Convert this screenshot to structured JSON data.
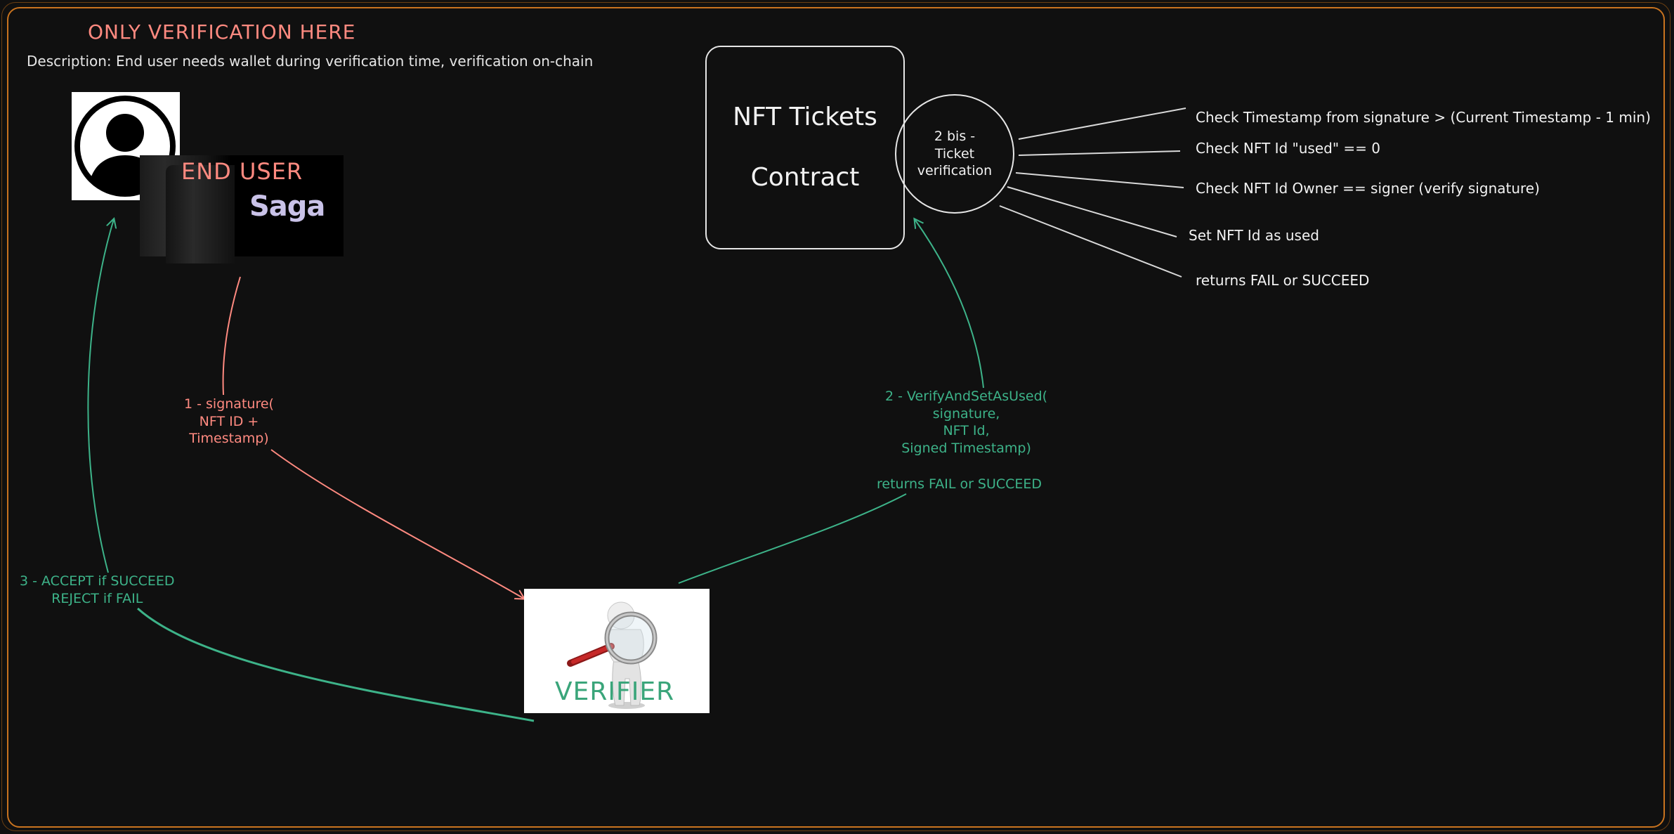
{
  "title": "ONLY VERIFICATION HERE",
  "description": "Description: End user needs wallet during verification time, verification on-chain",
  "contract": {
    "line1": "NFT Tickets",
    "line2": "Contract"
  },
  "verification_node": "2 bis -\nTicket\nverification",
  "checks": [
    "Check Timestamp from signature > (Current Timestamp - 1 min)",
    "Check NFT Id \"used\" == 0",
    "Check NFT Id Owner == signer (verify signature)",
    "Set NFT Id as used",
    "returns FAIL or SUCCEED"
  ],
  "end_user": {
    "label": "END USER",
    "brand": "Saga"
  },
  "verifier": {
    "label": "VERIFIER"
  },
  "step1": "1 - signature(\nNFT ID +\nTimestamp)",
  "step2": "2 - VerifyAndSetAsUsed(\nsignature,\nNFT Id,\nSigned Timestamp)",
  "step2_returns": "returns FAIL or SUCCEED",
  "step3": "3 - ACCEPT if SUCCEED\nREJECT if FAIL",
  "colors": {
    "frame": "#c8731f",
    "pink": "#ff8a80",
    "green": "#3db389",
    "stroke": "#e6e6e6",
    "background": "#101010"
  }
}
